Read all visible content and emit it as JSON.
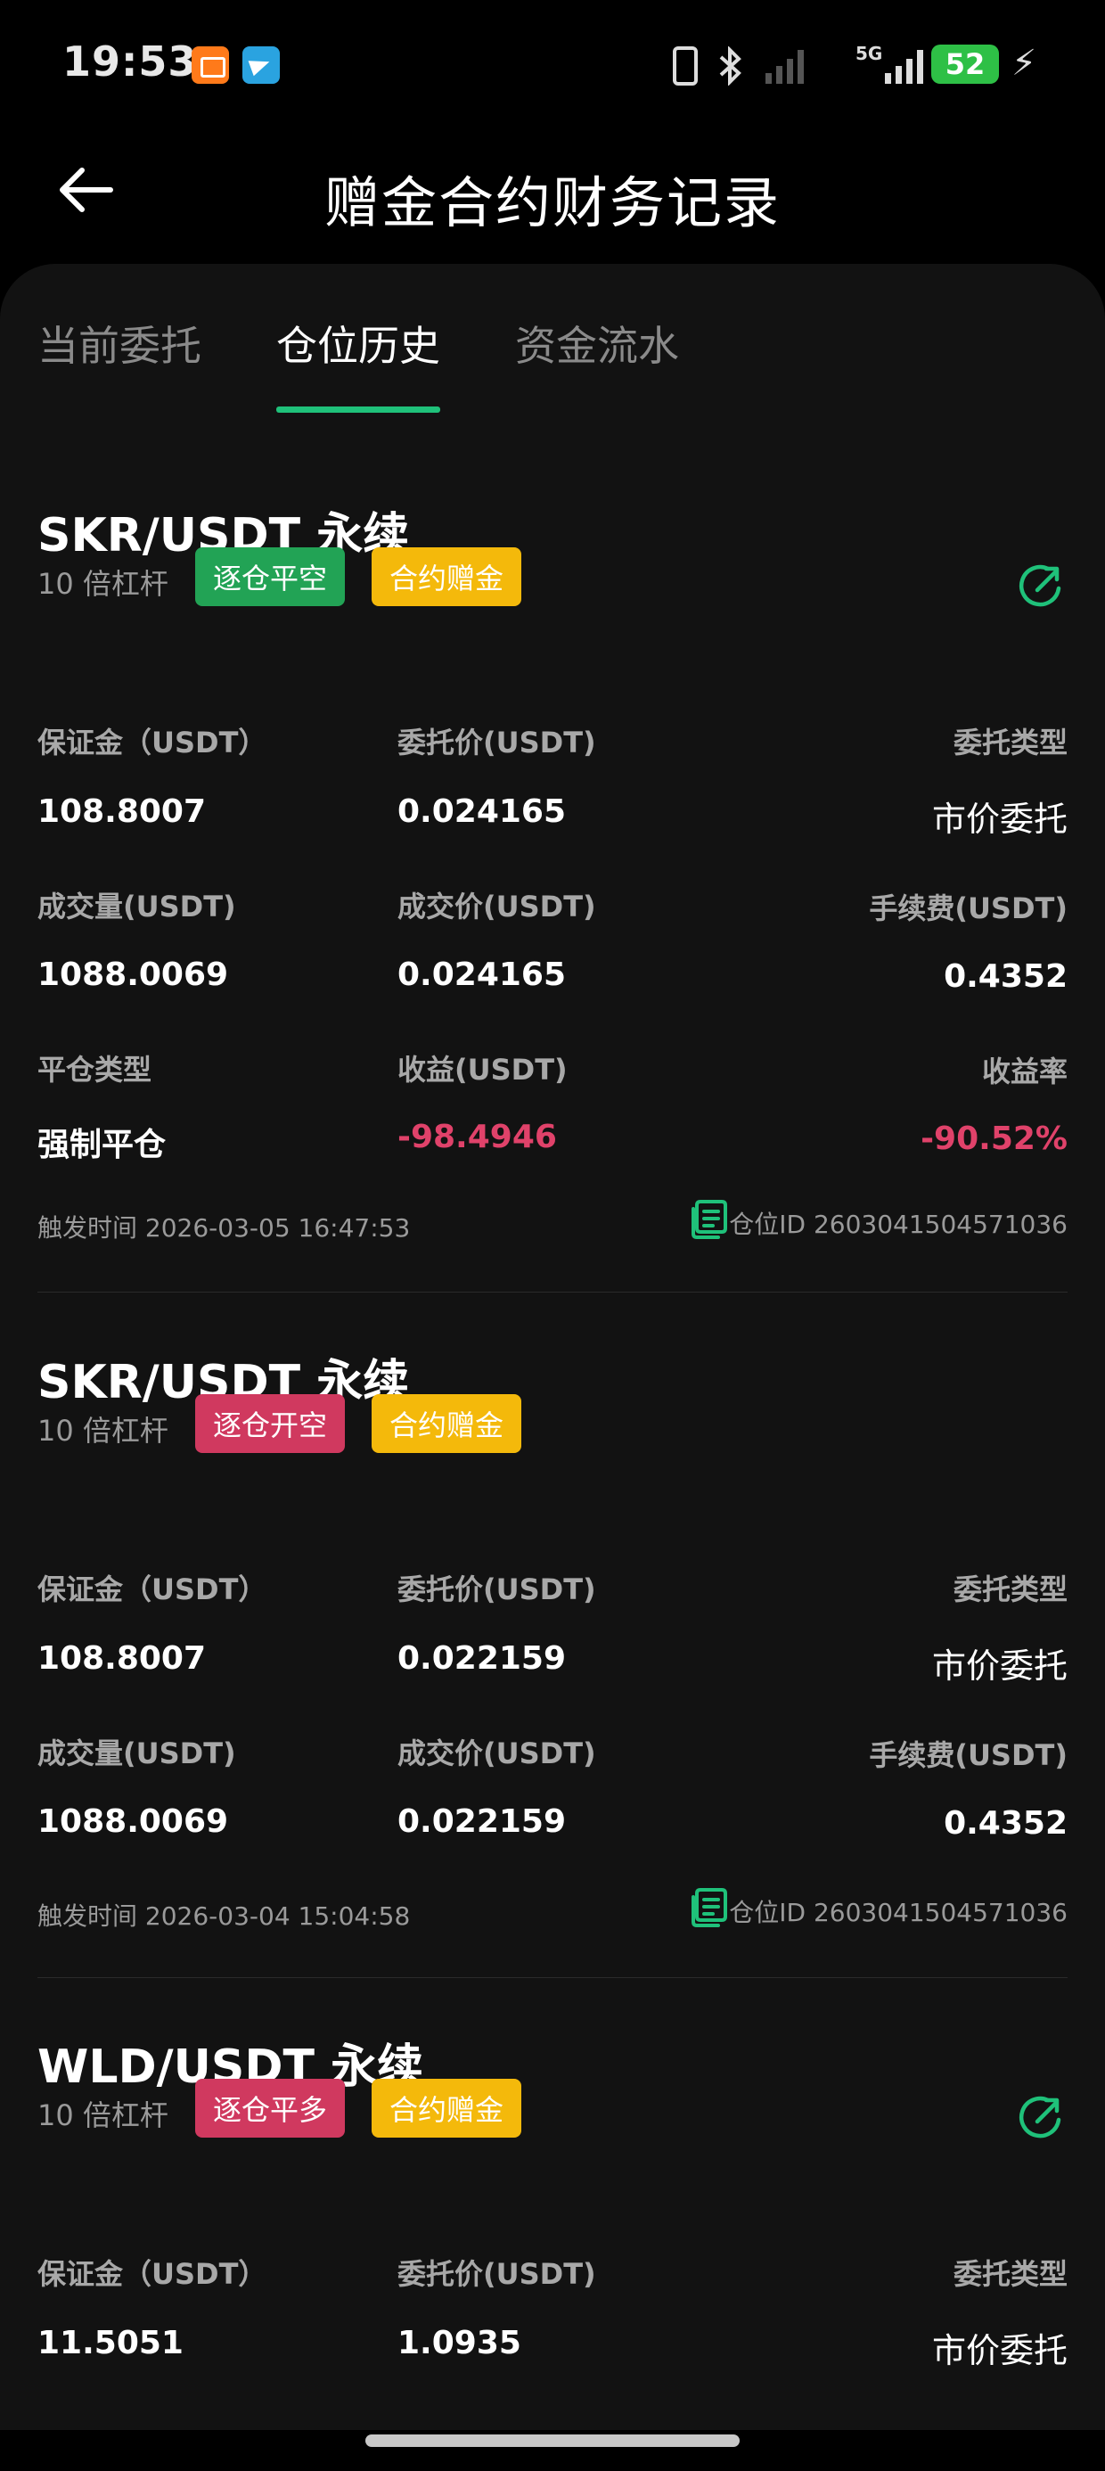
{
  "status_bar": {
    "time": "19:53",
    "network": "5G",
    "battery": "52"
  },
  "header": {
    "title": "赠金合约财务记录"
  },
  "tabs": [
    {
      "label": "当前委托",
      "active": false
    },
    {
      "label": "仓位历史",
      "active": true
    },
    {
      "label": "资金流水",
      "active": false
    }
  ],
  "labels": {
    "margin": "保证金（USDT）",
    "order_price": "委托价(USDT)",
    "order_type": "委托类型",
    "volume": "成交量(USDT)",
    "deal_price": "成交价(USDT)",
    "fee": "手续费(USDT)",
    "close_type": "平仓类型",
    "pnl": "收益(USDT)",
    "pnl_rate": "收益率",
    "trigger_time": "触发时间",
    "position_id": "仓位ID"
  },
  "records": [
    {
      "pair": "SKR/USDT 永续",
      "leverage": "10 倍杠杆",
      "tags": [
        {
          "label": "逐仓平空",
          "color": "#22a355"
        },
        {
          "label": "合约赠金",
          "color": "#f4b90b"
        }
      ],
      "margin": "108.8007",
      "order_price": "0.024165",
      "order_type": "市价委托",
      "volume": "1088.0069",
      "deal_price": "0.024165",
      "fee": "0.4352",
      "close_type": "强制平仓",
      "pnl": "-98.4946",
      "pnl_rate": "-90.52%",
      "trigger_time": "2026-03-05 16:47:53",
      "position_id": "2603041504571036"
    },
    {
      "pair": "SKR/USDT 永续",
      "leverage": "10 倍杠杆",
      "tags": [
        {
          "label": "逐仓开空",
          "color": "#d0395f"
        },
        {
          "label": "合约赠金",
          "color": "#f4b90b"
        }
      ],
      "margin": "108.8007",
      "order_price": "0.022159",
      "order_type": "市价委托",
      "volume": "1088.0069",
      "deal_price": "0.022159",
      "fee": "0.4352",
      "trigger_time": "2026-03-04 15:04:58",
      "position_id": "2603041504571036"
    },
    {
      "pair": "WLD/USDT 永续",
      "leverage": "10 倍杠杆",
      "tags": [
        {
          "label": "逐仓平多",
          "color": "#d0395f"
        },
        {
          "label": "合约赠金",
          "color": "#f4b90b"
        }
      ],
      "margin": "11.5051",
      "order_price": "1.0935",
      "order_type": "市价委托"
    }
  ],
  "colors": {
    "accent": "#1fc17a",
    "negative": "#e0426a",
    "background": "#121212"
  },
  "icons": {
    "back": "arrow-left-icon",
    "share": "share-icon",
    "copy": "copy-icon"
  }
}
